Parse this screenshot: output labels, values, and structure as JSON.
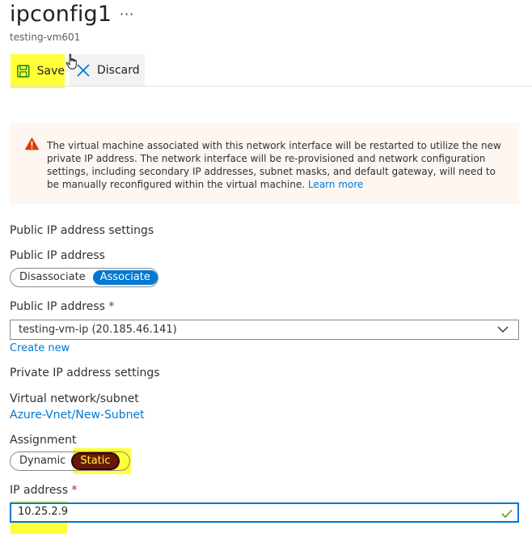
{
  "header": {
    "title": "ipconfig1",
    "more": "···",
    "subtitle": "testing-vm601"
  },
  "toolbar": {
    "save_label": "Save",
    "discard_label": "Discard"
  },
  "warning": {
    "text": "The virtual machine associated with this network interface will be restarted to utilize the new private IP address. The network interface will be re-provisioned and network configuration settings, including secondary IP addresses, subnet masks, and default gateway, will need to be manually reconfigured within the virtual machine. ",
    "link": "Learn more"
  },
  "public_ip": {
    "section_title": "Public IP address settings",
    "toggle_label": "Public IP address",
    "toggle_options": [
      "Disassociate",
      "Associate"
    ],
    "toggle_selected": "Associate",
    "select_label": "Public IP address",
    "required_mark": "*",
    "select_value": "testing-vm-ip (20.185.46.141)",
    "create_new": "Create new"
  },
  "private_ip": {
    "section_title": "Private IP address settings",
    "vnet_label": "Virtual network/subnet",
    "vnet_value": "Azure-Vnet/New-Subnet",
    "assignment_label": "Assignment",
    "assignment_options": [
      "Dynamic",
      "Static"
    ],
    "assignment_selected": "Static",
    "ip_label": "IP address",
    "required_mark": "*",
    "ip_value": "10.25.2.9"
  },
  "colors": {
    "accent": "#0078d4",
    "highlight": "#ffff3a",
    "static_selected": "#6b1708",
    "warning_bg": "#fdf6f1",
    "warning_icon": "#d83b01",
    "valid_check": "#57a300"
  },
  "icons": {
    "more": "ellipsis-icon",
    "save": "floppy-disk-icon",
    "discard": "close-icon",
    "warning": "warning-triangle-icon",
    "select": "chevron-down-icon",
    "valid": "checkmark-icon",
    "pointer": "hand-cursor-icon"
  }
}
